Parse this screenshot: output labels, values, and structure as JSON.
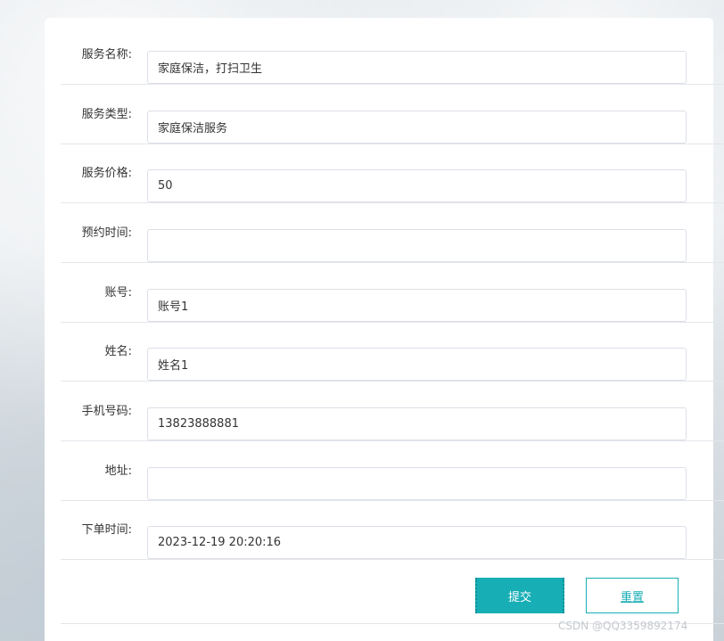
{
  "form": {
    "rows": [
      {
        "label": "服务名称:",
        "value": "家庭保洁，打扫卫生",
        "placeholder": ""
      },
      {
        "label": "服务类型:",
        "value": "家庭保洁服务",
        "placeholder": ""
      },
      {
        "label": "服务价格:",
        "value": "50",
        "placeholder": ""
      },
      {
        "label": "预约时间:",
        "value": "",
        "placeholder": ""
      },
      {
        "label": "账号:",
        "value": "账号1",
        "placeholder": ""
      },
      {
        "label": "姓名:",
        "value": "姓名1",
        "placeholder": ""
      },
      {
        "label": "手机号码:",
        "value": "13823888881",
        "placeholder": ""
      },
      {
        "label": "地址:",
        "value": "",
        "placeholder": ""
      },
      {
        "label": "下单时间:",
        "value": "2023-12-19 20:20:16",
        "placeholder": ""
      }
    ],
    "submit_label": "提交",
    "reset_label": "重置"
  },
  "watermark": "CSDN @QQ3359892174",
  "colors": {
    "accent": "#18aeb5",
    "border": "#dcdfe6",
    "divider": "#e3e6ea",
    "text": "#333333"
  }
}
